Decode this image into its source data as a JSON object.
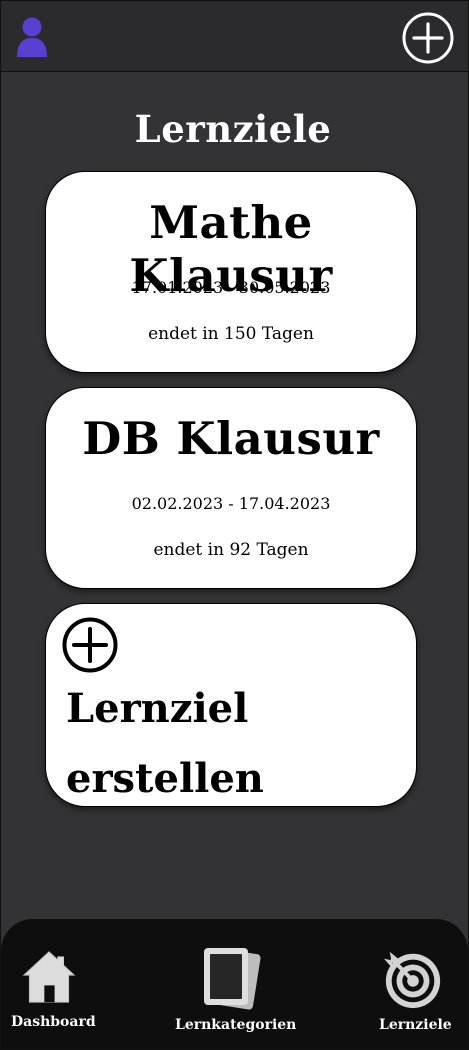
{
  "header": {
    "profile_icon": "user-icon",
    "add_icon": "plus-circle-icon",
    "accent_color": "#5b3fd1"
  },
  "page": {
    "title": "Lernziele"
  },
  "goals": [
    {
      "title": "Mathe Klausur",
      "dates": "17.01.2023 - 30.05.2023",
      "remaining": "endet in 150 Tagen"
    },
    {
      "title": "DB Klausur",
      "dates": "02.02.2023 - 17.04.2023",
      "remaining": "endet in 92 Tagen"
    }
  ],
  "create_card": {
    "icon": "plus-circle-icon",
    "label": "Lernziel\nerstellen"
  },
  "nav": {
    "items": [
      {
        "label": "Dashboard",
        "icon": "home-icon"
      },
      {
        "label": "Lernkategorien",
        "icon": "cards-icon"
      },
      {
        "label": "Lernziele",
        "icon": "target-icon"
      }
    ]
  }
}
